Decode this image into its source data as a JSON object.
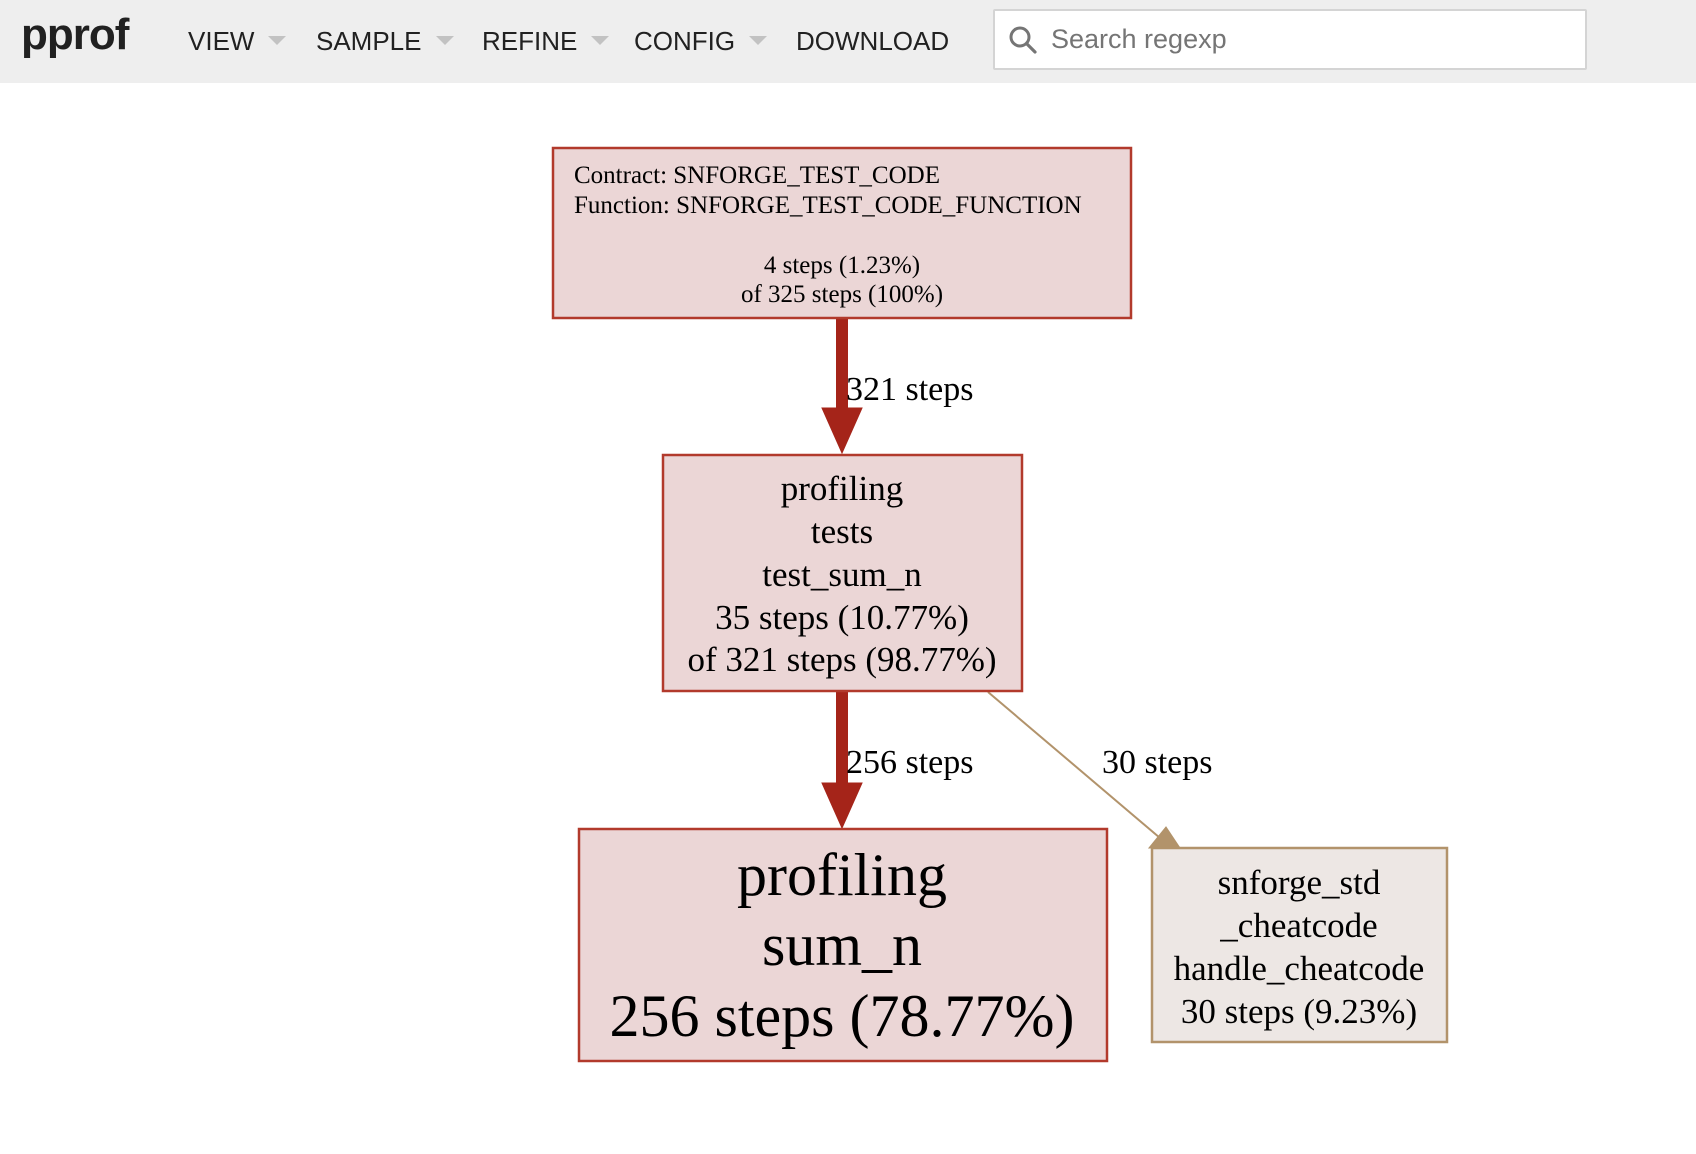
{
  "header": {
    "logo": "pprof",
    "menus": [
      {
        "label": "VIEW",
        "has_dropdown": true
      },
      {
        "label": "SAMPLE",
        "has_dropdown": true
      },
      {
        "label": "REFINE",
        "has_dropdown": true
      },
      {
        "label": "CONFIG",
        "has_dropdown": true
      },
      {
        "label": "DOWNLOAD",
        "has_dropdown": false
      }
    ],
    "search": {
      "placeholder": "Search regexp",
      "value": "",
      "icon": "search-icon"
    }
  },
  "graph": {
    "colors": {
      "hot_edge": "#a52419",
      "hot_border": "#b23a2c",
      "hot_fill": "#ebd6d6",
      "cold_edge": "#b2936b",
      "cold_border": "#b2936b",
      "cold_fill": "#ede7e4"
    },
    "nodes": [
      {
        "id": "root",
        "lines": [
          "Contract: SNFORGE_TEST_CODE",
          "Function: SNFORGE_TEST_CODE_FUNCTION"
        ],
        "flat": "4 steps (1.23%)",
        "cum": "of 325 steps (100%)",
        "style": "hot"
      },
      {
        "id": "test_sum_n",
        "lines": [
          "profiling",
          "tests",
          "test_sum_n"
        ],
        "flat": "35 steps (10.77%)",
        "cum": "of 321 steps (98.77%)",
        "style": "hot"
      },
      {
        "id": "sum_n",
        "lines": [
          "profiling",
          "sum_n"
        ],
        "flat": "256 steps (78.77%)",
        "cum": "",
        "style": "hot"
      },
      {
        "id": "handle_cheatcode",
        "lines": [
          "snforge_std",
          "_cheatcode",
          "handle_cheatcode"
        ],
        "flat": "30 steps (9.23%)",
        "cum": "",
        "style": "cold"
      }
    ],
    "edges": [
      {
        "from": "root",
        "to": "test_sum_n",
        "label": "321 steps",
        "style": "hot"
      },
      {
        "from": "test_sum_n",
        "to": "sum_n",
        "label": "256 steps",
        "style": "hot"
      },
      {
        "from": "test_sum_n",
        "to": "handle_cheatcode",
        "label": "30 steps",
        "style": "cold"
      }
    ]
  }
}
